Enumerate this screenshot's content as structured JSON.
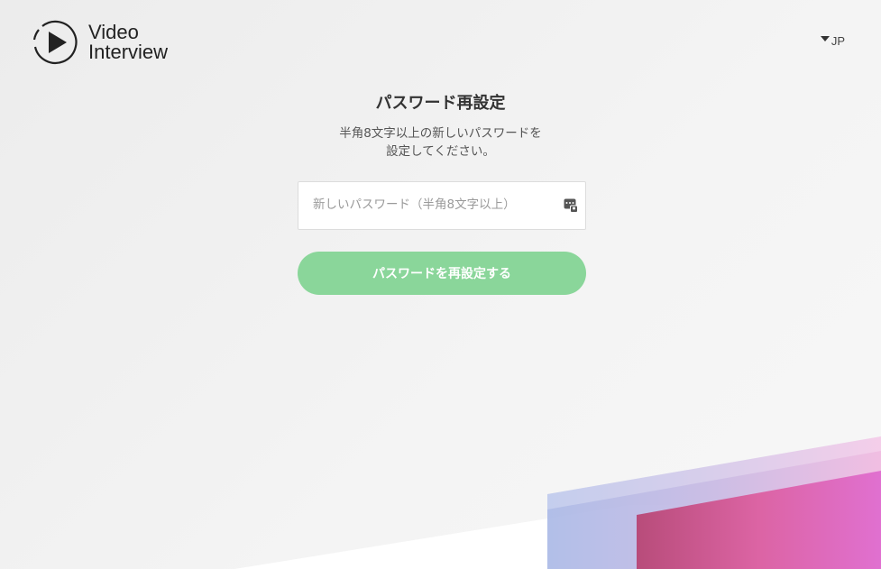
{
  "brand": {
    "name_line1": "Video",
    "name_line2": "Interview"
  },
  "language": {
    "current": "JP"
  },
  "form": {
    "title": "パスワード再設定",
    "description_line1": "半角8文字以上の新しいパスワードを",
    "description_line2": "設定してください。",
    "password_placeholder": "新しいパスワード（半角8文字以上）",
    "password_value": "",
    "submit_label": "パスワードを再設定する"
  },
  "colors": {
    "button": "#8ad69a",
    "background": "#f0f0f0",
    "decor_blue": "#a9b8e6",
    "decor_pink": "#e070b8"
  },
  "icons": {
    "logo": "play-circle-icon",
    "language": "caret-down-icon",
    "password": "password-key-icon"
  }
}
